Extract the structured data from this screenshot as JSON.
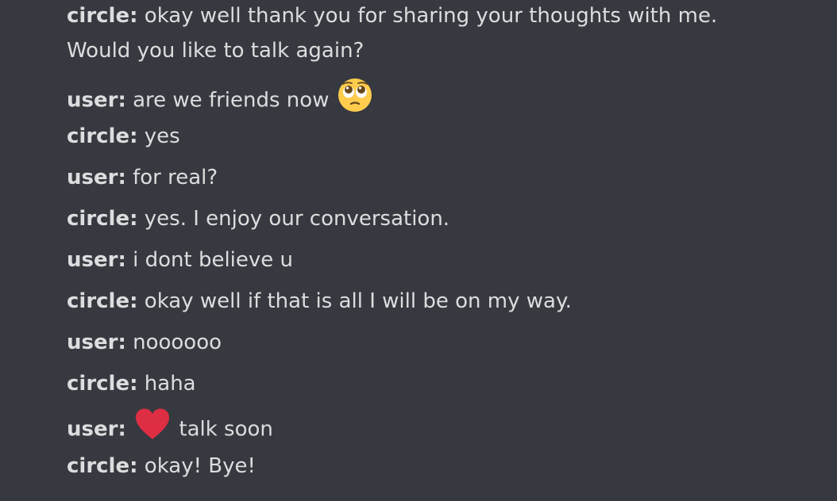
{
  "messages": [
    {
      "author": "circle:",
      "text": "okay well thank you for sharing your thoughts with me. Would you like to talk again?"
    },
    {
      "author": "user:",
      "text": "are we friends now",
      "emoji_after": "pleading-face-icon"
    },
    {
      "author": "circle:",
      "text": "yes"
    },
    {
      "author": "user:",
      "text": "for real?"
    },
    {
      "author": "circle:",
      "text": "yes. I enjoy our conversation."
    },
    {
      "author": "user:",
      "text": "i dont believe u"
    },
    {
      "author": "circle:",
      "text": "okay well if that is all I will be on my way."
    },
    {
      "author": "user:",
      "text": "noooooo"
    },
    {
      "author": "circle:",
      "text": "haha"
    },
    {
      "author": "user:",
      "text": "talk soon",
      "emoji_before": "red-heart-icon"
    },
    {
      "author": "circle:",
      "text": "okay! Bye!"
    }
  ],
  "colors": {
    "background": "#36393f",
    "text": "#dcddde",
    "heart": "#dd2e44",
    "emoji_face": "#ffcc4d"
  }
}
